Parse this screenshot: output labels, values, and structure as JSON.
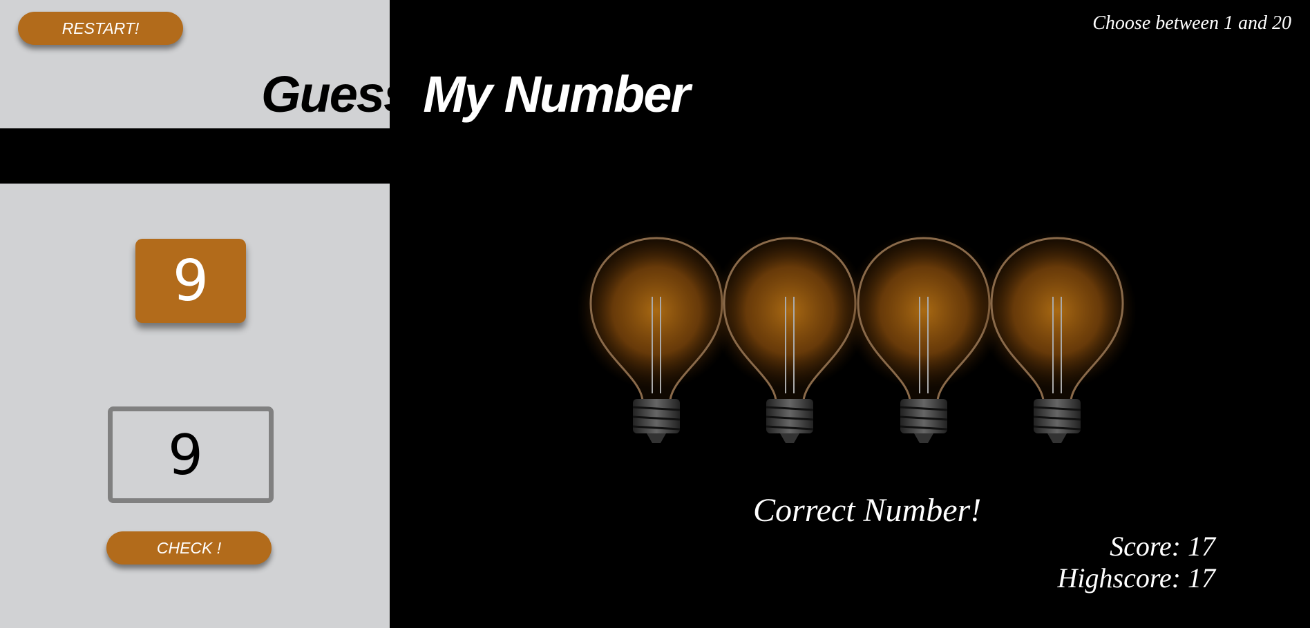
{
  "header": {
    "restart_label": "RESTART!",
    "range_hint": "Choose between 1 and 20",
    "title_word1": "Guess",
    "title_word2": "My Number"
  },
  "game": {
    "secret_number": "9",
    "guess_value": "9",
    "check_label": "CHECK !",
    "message": "Correct Number!",
    "score_text": "Score: 17",
    "highscore_text": "Highscore: 17"
  },
  "colors": {
    "accent": "#b26b1b",
    "left_panel": "#d1d2d4",
    "background": "#000000"
  }
}
